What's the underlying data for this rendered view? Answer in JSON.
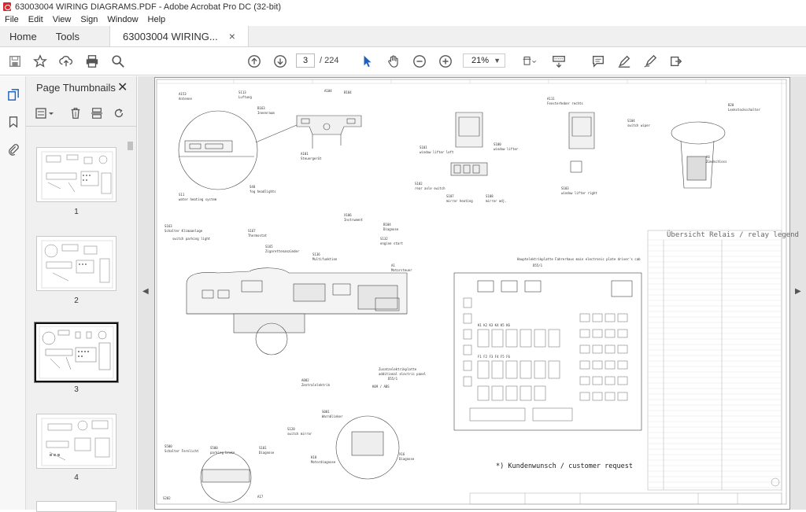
{
  "window": {
    "title": "63003004 WIRING DIAGRAMS.PDF - Adobe Acrobat Pro DC (32-bit)"
  },
  "menu": [
    "File",
    "Edit",
    "View",
    "Sign",
    "Window",
    "Help"
  ],
  "tabs": {
    "home": "Home",
    "tools": "Tools",
    "document": "63003004 WIRING...",
    "close": "×"
  },
  "toolbar": {
    "page_current": "3",
    "page_total": "/ 224",
    "zoom": "21%",
    "icons": [
      "save-icon",
      "bookmark-star-icon",
      "upload-icon",
      "print-icon",
      "search-icon",
      "prev-page-icon",
      "next-page-icon",
      "select-cursor-icon",
      "hand-icon",
      "zoom-out-icon",
      "zoom-in-icon",
      "page-fit-icon",
      "scroll-mode-icon",
      "comment-icon",
      "highlight-icon",
      "sign-icon",
      "share-icon"
    ]
  },
  "panel": {
    "title": "Page Thumbnails",
    "close": "✕",
    "thumbnails": [
      {
        "label": "1"
      },
      {
        "label": "2"
      },
      {
        "label": "3",
        "selected": true
      },
      {
        "label": "4"
      }
    ]
  },
  "document": {
    "customer_note": "*) Kundenwunsch / customer request",
    "legend_title": "Übersicht Relais / relay legend",
    "main_panel_title": "Hauptelektrikplatte Fahrerhaus main electronic plate driver's cab"
  },
  "colors": {
    "accent": "#d7282f",
    "selection": "#111111",
    "link_blue": "#1f5fbf"
  }
}
